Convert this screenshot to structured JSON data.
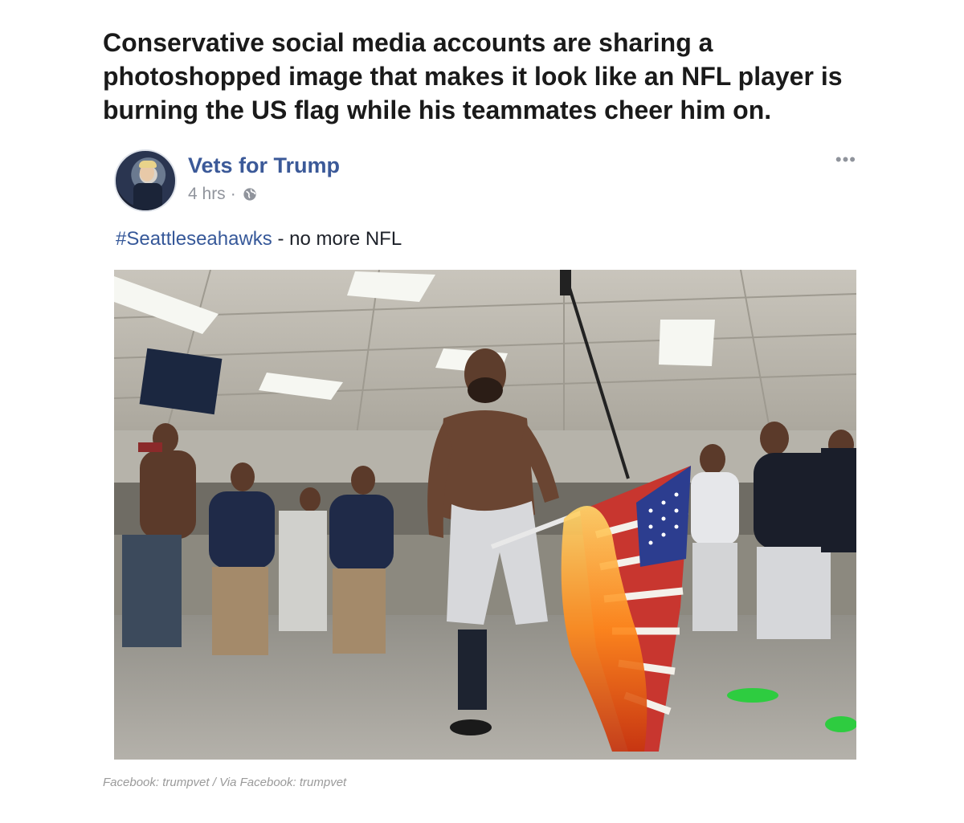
{
  "headline": "Conservative social media accounts are sharing a photoshopped image that makes it look like an NFL player is burning the US flag while his teammates cheer him on.",
  "post": {
    "page_name": "Vets for Trump",
    "time": "4 hrs",
    "separator": "·",
    "privacy_icon": "globe-icon",
    "more_icon": "ellipsis-icon",
    "more_label": "•••",
    "hashtag": "#Seattleseahawks",
    "text": " - no more NFL",
    "link_color": "#3b5998"
  },
  "caption": "Facebook: trumpvet / Via Facebook: trumpvet"
}
